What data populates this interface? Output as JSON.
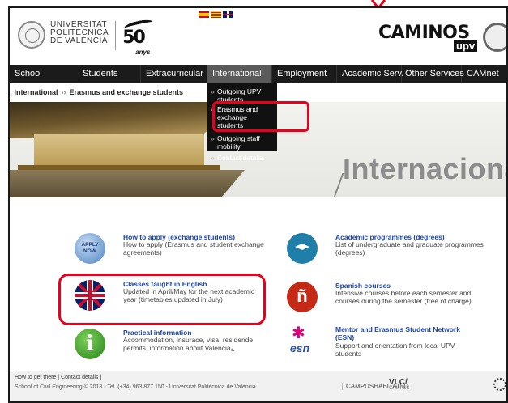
{
  "header": {
    "upv_name_lines": [
      "UNIVERSITAT",
      "POLITÈCNICA",
      "DE VALÈNCIA"
    ],
    "anniversary_number": "50",
    "anniversary_label": "anys",
    "languages": [
      "es-flag-icon",
      "ca-flag-icon",
      "en-flag-icon"
    ],
    "school_brand": "CAMINOS",
    "school_brand_sub": "upv"
  },
  "nav": {
    "items": [
      "School",
      "Students",
      "Extracurricular",
      "International",
      "Employment",
      "Academic Serv.",
      "Other Services",
      "CAMnet"
    ],
    "active": "International"
  },
  "dropdown": {
    "items": [
      "Outgoing UPV students",
      "Erasmus and exchange students",
      "Outgoing staff mobility",
      "Contact details"
    ]
  },
  "breadcrumb": {
    "items": [
      "International",
      "Erasmus and exchange students"
    ],
    "separator": "››"
  },
  "hero": {
    "title": "Internaciona"
  },
  "cards": [
    {
      "icon": "apply-now-icon",
      "icon_text": "APPLY NOW",
      "title": "How to apply (exchange students)",
      "desc": "How to apply (Erasmus and student exchange agreements)"
    },
    {
      "icon": "graduation-cap-icon",
      "title": "Academic programmes (degrees)",
      "desc": "List of undergraduate and graduate programmes (degrees)"
    },
    {
      "icon": "uk-flag-icon",
      "title": "Classes taught in English",
      "desc": "Updated in April/May for the next academic year (timetables updated in July)"
    },
    {
      "icon": "spanish-enye-icon",
      "icon_text": "ñ",
      "title": "Spanish courses",
      "desc": "Intensive courses before each semester and courses during the semester (free of charge)"
    },
    {
      "icon": "info-icon",
      "icon_text": "i",
      "title": "Practical information",
      "desc": "Accommodation, Insurace, visa, residende permits, information about Valencia¿"
    },
    {
      "icon": "esn-logo-icon",
      "icon_text": "esn",
      "title": "Mentor and Erasmus Student Network (ESN)",
      "desc": "Support and orientation from local UPV students"
    }
  ],
  "footer": {
    "links": "How to get there | Contact details |",
    "copyright": "School of Civil Engineering © 2018 - Tel. (+34) 963 877 150 - Universitat Politècnica de València",
    "campus": "CAMPUSHABITAT5U",
    "vlc": "VLC/",
    "vlc_sub": "CAMPUS"
  },
  "colors": {
    "nav_bg": "#1b1b1b",
    "nav_active": "#5a5a5a",
    "link_blue": "#1a44a8",
    "highlight_red": "#e8001c"
  }
}
